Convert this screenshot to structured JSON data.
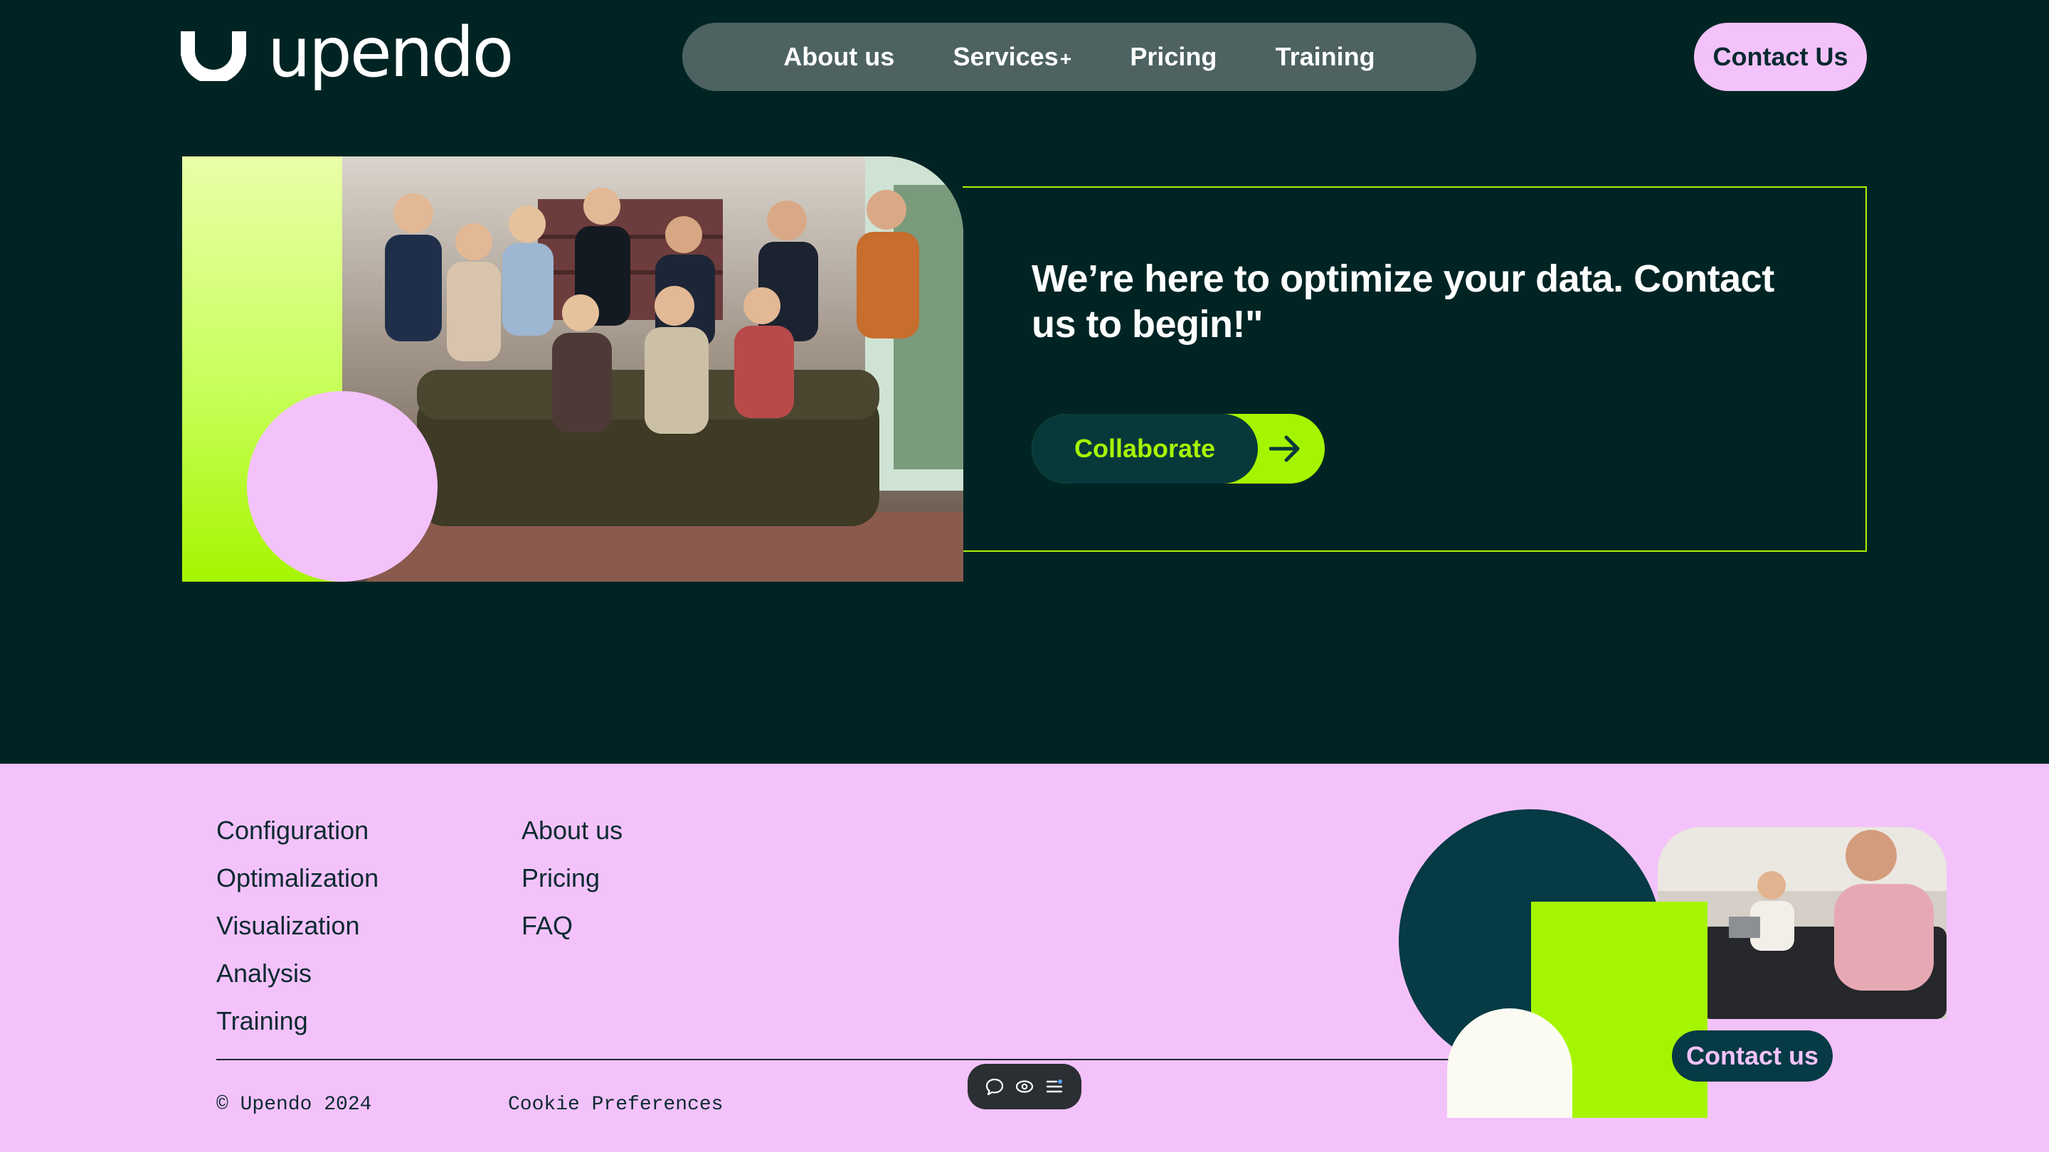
{
  "brand": {
    "name": "upendo",
    "logo_icon": "upendo-u-mark-icon"
  },
  "nav": {
    "items": [
      {
        "label": "About us"
      },
      {
        "label": "Services",
        "suffix": "+"
      },
      {
        "label": "Pricing"
      },
      {
        "label": "Training"
      }
    ],
    "contact_label": "Contact Us"
  },
  "hero": {
    "heading": "We’re here to optimize your data. Contact us to begin!\"",
    "cta_label": "Collaborate",
    "cta_icon": "arrow-right-icon"
  },
  "footer": {
    "services": [
      "Configuration",
      "Optimalization",
      "Visualization",
      "Analysis",
      "Training"
    ],
    "company": [
      "About us",
      "Pricing",
      "FAQ"
    ],
    "copyright": "© Upendo 2024",
    "cookie_label": "Cookie Preferences",
    "contact_label": "Contact us"
  },
  "toolbar": {
    "icons": [
      "chat-bubble-icon",
      "eye-icon",
      "list-menu-icon"
    ]
  },
  "colors": {
    "background": "#002424",
    "lime": "#a6f500",
    "pink": "#f4c2fb",
    "teal": "#063a44",
    "nav_pill": "#4e6262"
  }
}
